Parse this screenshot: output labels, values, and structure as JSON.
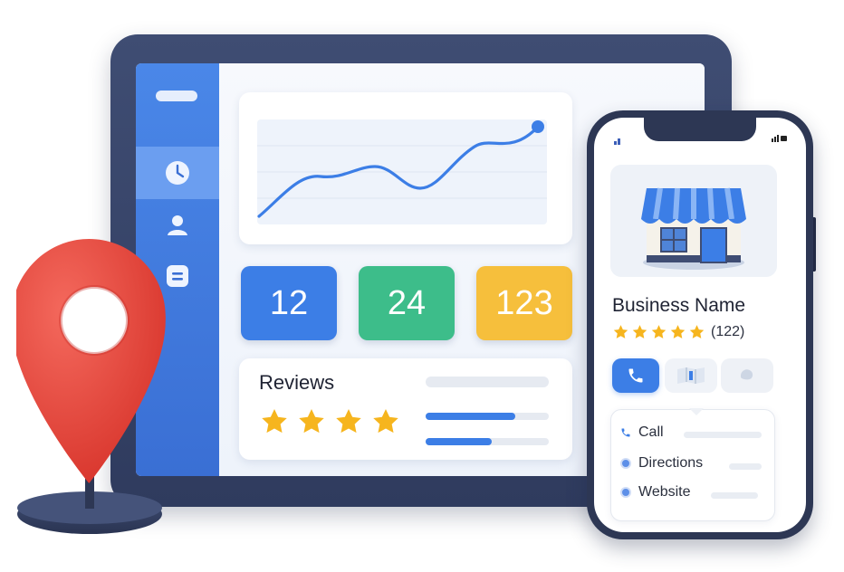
{
  "sidebar": {
    "items": [
      {
        "icon": "clock-icon",
        "active": true
      },
      {
        "icon": "user-icon",
        "active": false
      },
      {
        "icon": "list-icon",
        "active": false
      }
    ]
  },
  "stats": [
    "12",
    "24",
    "123"
  ],
  "reviews": {
    "title": "Reviews",
    "stars": 4,
    "bars": [
      0.73,
      0.54
    ]
  },
  "phone": {
    "business_name": "Business Name",
    "rating_stars": 5,
    "rating_count": "(122)",
    "actions": [
      {
        "icon": "phone-icon"
      },
      {
        "icon": "map-icon"
      },
      {
        "icon": "chat-icon"
      }
    ],
    "contact": [
      {
        "icon": "phone-icon",
        "label": "Call"
      },
      {
        "icon": "location-dot-icon",
        "label": "Directions"
      },
      {
        "icon": "globe-dot-icon",
        "label": "Website"
      }
    ]
  },
  "colors": {
    "primary": "#3c7ee6",
    "green": "#3dbd8a",
    "yellow": "#f6bf3c",
    "pin": "#e8443a",
    "star": "#f6b51e"
  }
}
